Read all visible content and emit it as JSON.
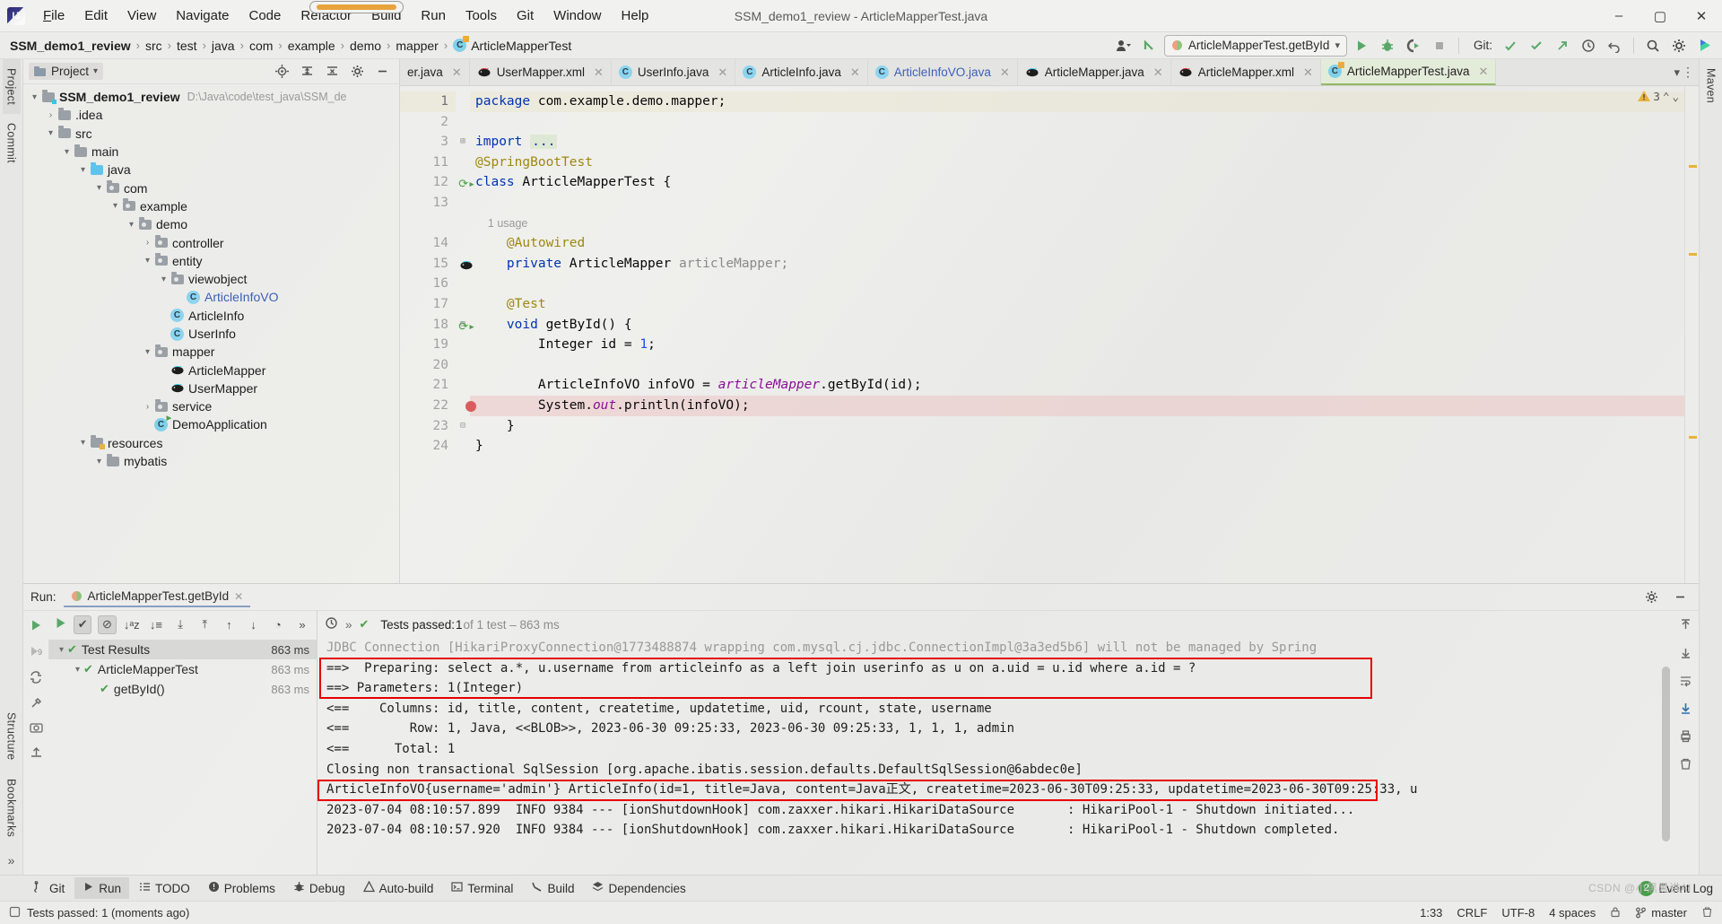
{
  "window": {
    "title": "SSM_demo1_review - ArticleMapperTest.java",
    "logo": "intellij-idea-logo",
    "minimize": "–",
    "maximize": "▢",
    "close": "✕"
  },
  "menubar": {
    "items": [
      {
        "label": "File"
      },
      {
        "label": "Edit"
      },
      {
        "label": "View"
      },
      {
        "label": "Navigate"
      },
      {
        "label": "Code"
      },
      {
        "label": "Refactor"
      },
      {
        "label": "Build"
      },
      {
        "label": "Run"
      },
      {
        "label": "Tools"
      },
      {
        "label": "Git"
      },
      {
        "label": "Window"
      },
      {
        "label": "Help"
      }
    ]
  },
  "navbar": {
    "crumbs": [
      {
        "label": "SSM_demo1_review",
        "bold": true
      },
      {
        "label": "src"
      },
      {
        "label": "test"
      },
      {
        "label": "java"
      },
      {
        "label": "com"
      },
      {
        "label": "example"
      },
      {
        "label": "demo"
      },
      {
        "label": "mapper"
      },
      {
        "label": "ArticleMapperTest",
        "icon": "class-test-icon"
      }
    ],
    "separator": "›",
    "run_config": "ArticleMapperTest.getById",
    "run_config_chevron": "▾",
    "git_label": "Git:",
    "icons": {
      "profile": "user-icon",
      "update": "update-project-icon",
      "run": "run-icon",
      "debug": "debug-icon",
      "coverage": "run-with-coverage-icon",
      "stop": "stop-icon",
      "git_check": "git-commit-icon",
      "git_update": "git-update-icon",
      "git_push": "git-push-icon",
      "history": "history-icon",
      "undo": "undo-icon",
      "search": "search-icon",
      "settings": "gear-icon",
      "ai": "ai-assistant-icon"
    }
  },
  "left_rail": {
    "tabs": [
      {
        "label": "Project",
        "selected": true
      },
      {
        "label": "Commit"
      }
    ],
    "icons": [
      "structure-icon",
      "bookmarks-icon"
    ]
  },
  "right_rail": {
    "tabs": [
      {
        "label": "Maven"
      }
    ]
  },
  "project": {
    "title": "Project",
    "title_chevron": "▾",
    "header_icons": [
      "select-opened-file-icon",
      "expand-all-icon",
      "collapse-all-icon",
      "gear-icon",
      "hide-icon"
    ],
    "tree": [
      {
        "depth": 0,
        "arrow": "▾",
        "icon": "module-folder",
        "label": "SSM_demo1_review",
        "bold": true,
        "path": "D:\\Java\\code\\test_java\\SSM_de"
      },
      {
        "depth": 1,
        "arrow": "›",
        "icon": "folder",
        "label": ".idea"
      },
      {
        "depth": 1,
        "arrow": "▾",
        "icon": "folder",
        "label": "src"
      },
      {
        "depth": 2,
        "arrow": "▾",
        "icon": "folder",
        "label": "main"
      },
      {
        "depth": 3,
        "arrow": "▾",
        "icon": "source-folder",
        "label": "java"
      },
      {
        "depth": 4,
        "arrow": "▾",
        "icon": "package",
        "label": "com"
      },
      {
        "depth": 5,
        "arrow": "▾",
        "icon": "package",
        "label": "example"
      },
      {
        "depth": 6,
        "arrow": "▾",
        "icon": "package",
        "label": "demo"
      },
      {
        "depth": 7,
        "arrow": "›",
        "icon": "package",
        "label": "controller"
      },
      {
        "depth": 7,
        "arrow": "▾",
        "icon": "package",
        "label": "entity"
      },
      {
        "depth": 8,
        "arrow": "▾",
        "icon": "package",
        "label": "viewobject"
      },
      {
        "depth": 9,
        "arrow": "",
        "icon": "class",
        "label": "ArticleInfoVO",
        "blue": true
      },
      {
        "depth": 8,
        "arrow": "",
        "icon": "class",
        "label": "ArticleInfo"
      },
      {
        "depth": 8,
        "arrow": "",
        "icon": "class",
        "label": "UserInfo"
      },
      {
        "depth": 7,
        "arrow": "▾",
        "icon": "package",
        "label": "mapper"
      },
      {
        "depth": 8,
        "arrow": "",
        "icon": "mybatis",
        "label": "ArticleMapper"
      },
      {
        "depth": 8,
        "arrow": "",
        "icon": "mybatis",
        "label": "UserMapper"
      },
      {
        "depth": 7,
        "arrow": "›",
        "icon": "package",
        "label": "service"
      },
      {
        "depth": 7,
        "arrow": "",
        "icon": "class-run",
        "label": "DemoApplication"
      },
      {
        "depth": 3,
        "arrow": "▾",
        "icon": "resource-folder",
        "label": "resources"
      },
      {
        "depth": 4,
        "arrow": "▾",
        "icon": "folder",
        "label": "mybatis"
      }
    ]
  },
  "editor": {
    "tabs": [
      {
        "label": "er.java",
        "icon": "class",
        "clipped": true
      },
      {
        "label": "UserMapper.xml",
        "icon": "mybatis"
      },
      {
        "label": "UserInfo.java",
        "icon": "class"
      },
      {
        "label": "ArticleInfo.java",
        "icon": "class"
      },
      {
        "label": "ArticleInfoVO.java",
        "icon": "class",
        "blue": true
      },
      {
        "label": "ArticleMapper.java",
        "icon": "mybatis"
      },
      {
        "label": "ArticleMapper.xml",
        "icon": "mybatis"
      },
      {
        "label": "ArticleMapperTest.java",
        "icon": "class-test",
        "active": true
      }
    ],
    "tab_close": "✕",
    "tabs_overflow": "▾",
    "tabs_more": "⋮",
    "inspection_badge": {
      "icon": "warning-icon",
      "count": "3",
      "chevron_up": "⌃",
      "chevron_down": "⌄"
    },
    "lines": [
      {
        "num": "1",
        "current": true,
        "tokens": [
          {
            "t": "package",
            "c": "kw"
          },
          {
            "t": " com.example.demo.mapper;",
            "c": "pl"
          }
        ]
      },
      {
        "num": "2",
        "tokens": []
      },
      {
        "num": "3",
        "fold": "⊞",
        "tokens": [
          {
            "t": "import",
            "c": "kw"
          },
          {
            "t": " ",
            "c": "pl"
          },
          {
            "t": "...",
            "c": "imp-fold"
          }
        ]
      },
      {
        "num": "11",
        "tokens": [
          {
            "t": "@SpringBootTest",
            "c": "ann"
          }
        ]
      },
      {
        "num": "12",
        "gutter_icon": "run-test-icon",
        "tokens": [
          {
            "t": "class",
            "c": "kw"
          },
          {
            "t": " ArticleMapperTest {",
            "c": "pl"
          }
        ]
      },
      {
        "num": "13",
        "tokens": []
      },
      {
        "num": "",
        "usage": "1 usage"
      },
      {
        "num": "14",
        "tokens": [
          {
            "t": "    @Autowired",
            "c": "ann"
          }
        ]
      },
      {
        "num": "15",
        "gutter_icon": "mybatis-icon",
        "tokens": [
          {
            "t": "    ",
            "c": "pl"
          },
          {
            "t": "private",
            "c": "kw"
          },
          {
            "t": " ArticleMapper ",
            "c": "pl"
          },
          {
            "t": "articleMapper;",
            "c": "var"
          }
        ]
      },
      {
        "num": "16",
        "tokens": []
      },
      {
        "num": "17",
        "tokens": [
          {
            "t": "    @Test",
            "c": "ann"
          }
        ]
      },
      {
        "num": "18",
        "gutter_icon": "run-test-icon",
        "fold": "⊟",
        "tokens": [
          {
            "t": "    ",
            "c": "pl"
          },
          {
            "t": "void",
            "c": "kw"
          },
          {
            "t": " getById() {",
            "c": "pl"
          }
        ]
      },
      {
        "num": "19",
        "tokens": [
          {
            "t": "        Integer id = ",
            "c": "pl"
          },
          {
            "t": "1",
            "c": "num"
          },
          {
            "t": ";",
            "c": "pl"
          }
        ]
      },
      {
        "num": "20",
        "tokens": []
      },
      {
        "num": "21",
        "tokens": [
          {
            "t": "        ArticleInfoVO infoVO = ",
            "c": "pl"
          },
          {
            "t": "articleMapper",
            "c": "fld"
          },
          {
            "t": ".getById(id);",
            "c": "pl"
          }
        ]
      },
      {
        "num": "22",
        "breakpoint": true,
        "highlight": true,
        "tokens": [
          {
            "t": "        System.",
            "c": "pl"
          },
          {
            "t": "out",
            "c": "fld"
          },
          {
            "t": ".println(infoVO);",
            "c": "pl"
          }
        ]
      },
      {
        "num": "23",
        "fold": "⊟",
        "tokens": [
          {
            "t": "    }",
            "c": "pl"
          }
        ]
      },
      {
        "num": "24",
        "tokens": [
          {
            "t": "}",
            "c": "pl"
          }
        ]
      }
    ]
  },
  "run_window": {
    "label": "Run:",
    "tab_title": "ArticleMapperTest.getById",
    "tab_icon": "test-config-icon",
    "tab_close": "✕",
    "header_icons": [
      "gear-icon",
      "hide-icon"
    ],
    "side_icons": [
      "rerun-icon",
      "rerun-failed-icon",
      "toggle-auto-test-icon"
    ],
    "toolbar_buttons": [
      {
        "name": "show-passed",
        "glyph": "✔",
        "on": true
      },
      {
        "name": "show-ignored",
        "glyph": "⊘",
        "on": true
      },
      {
        "name": "sort-alphabetically",
        "glyph": "↓ᵃz"
      },
      {
        "name": "sort-by-duration",
        "glyph": "↓≡"
      },
      {
        "name": "expand-all",
        "glyph": "⤓"
      },
      {
        "name": "collapse-all",
        "glyph": "⤒"
      },
      {
        "name": "previous-failed",
        "glyph": "↑"
      },
      {
        "name": "next-failed",
        "glyph": "↓"
      },
      {
        "name": "test-history",
        "glyph": "◔"
      },
      {
        "name": "more",
        "glyph": "»"
      }
    ],
    "status": {
      "prefix": "Tests passed: ",
      "count": "1",
      "suffix": " of 1 test – 863 ms"
    },
    "tree": [
      {
        "depth": 0,
        "arrow": "▾",
        "label": "Test Results",
        "time": "863 ms",
        "selected": true
      },
      {
        "depth": 1,
        "arrow": "▾",
        "label": "ArticleMapperTest",
        "time": "863 ms"
      },
      {
        "depth": 2,
        "arrow": "",
        "label": "getById()",
        "time": "863 ms"
      }
    ],
    "console": {
      "lines": [
        {
          "text": "JDBC Connection [HikariProxyConnection@1773488874 wrapping com.mysql.cj.jdbc.ConnectionImpl@3a3ed5b6] will not be managed by Spring",
          "dim": true
        },
        {
          "text": "==>  Preparing: select a.*, u.username from articleinfo as a left join userinfo as u on a.uid = u.id where a.id = ?"
        },
        {
          "text": "==> Parameters: 1(Integer)"
        },
        {
          "text": "<==    Columns: id, title, content, createtime, updatetime, uid, rcount, state, username"
        },
        {
          "text": "<==        Row: 1, Java, <<BLOB>>, 2023-06-30 09:25:33, 2023-06-30 09:25:33, 1, 1, 1, admin"
        },
        {
          "text": "<==      Total: 1"
        },
        {
          "text": "Closing non transactional SqlSession [org.apache.ibatis.session.defaults.DefaultSqlSession@6abdec0e]"
        },
        {
          "text": "ArticleInfoVO{username='admin'} ArticleInfo(id=1, title=Java, content=Java正文, createtime=2023-06-30T09:25:33, updatetime=2023-06-30T09:25:33, u"
        },
        {
          "text": "2023-07-04 08:10:57.899  INFO 9384 --- [ionShutdownHook] com.zaxxer.hikari.HikariDataSource       : HikariPool-1 - Shutdown initiated..."
        },
        {
          "text": "2023-07-04 08:10:57.920  INFO 9384 --- [ionShutdownHook] com.zaxxer.hikari.HikariDataSource       : HikariPool-1 - Shutdown completed."
        }
      ],
      "highlight_color": "#e60000",
      "side_icons": [
        "scroll-up-icon",
        "scroll-down-icon",
        "soft-wrap-icon",
        "scroll-to-end-icon",
        "print-icon",
        "clear-all-icon"
      ]
    }
  },
  "toolwindow_bar": {
    "items": [
      {
        "label": "Git",
        "icon": "git-icon"
      },
      {
        "label": "Run",
        "icon": "run-icon",
        "active": true
      },
      {
        "label": "TODO",
        "icon": "todo-icon"
      },
      {
        "label": "Problems",
        "icon": "problems-icon"
      },
      {
        "label": "Debug",
        "icon": "debug-icon"
      },
      {
        "label": "Auto-build",
        "icon": "auto-build-icon"
      },
      {
        "label": "Terminal",
        "icon": "terminal-icon"
      },
      {
        "label": "Build",
        "icon": "build-icon"
      },
      {
        "label": "Dependencies",
        "icon": "dependencies-icon"
      }
    ],
    "event_log": {
      "label": "Event Log",
      "count": "2"
    }
  },
  "statusbar": {
    "message": "Tests passed: 1 (moments ago)",
    "message_icon": "balloon-icon",
    "caret": "1:33",
    "line_separator": "CRLF",
    "encoding": "UTF-8",
    "indent": "4 spaces",
    "branch": "master",
    "branch_icon": "git-branch-icon",
    "lock_icon": "lock-icon"
  },
  "watermark": "CSDN @小黑黑讲AI"
}
